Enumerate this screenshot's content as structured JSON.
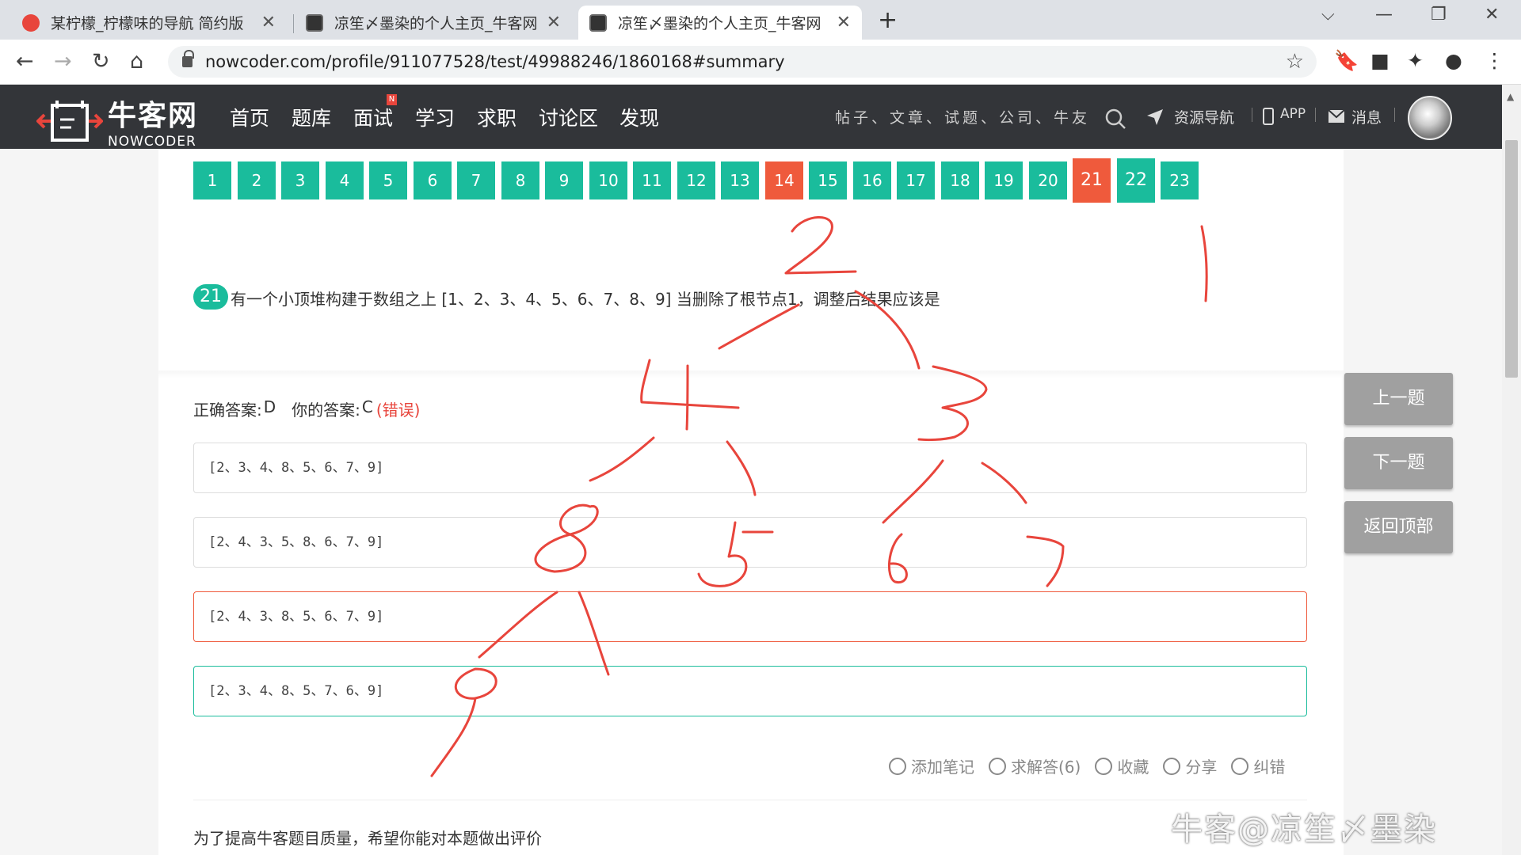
{
  "browser": {
    "tabs": [
      {
        "title": "某柠檬_柠檬味的导航 简约版",
        "active": false,
        "icon": "lemon-icon",
        "color": "#e8453c"
      },
      {
        "title": "凉笙〆墨染的个人主页_牛客网",
        "active": false,
        "icon": "nowcoder-icon",
        "color": "#333"
      },
      {
        "title": "凉笙〆墨染的个人主页_牛客网",
        "active": true,
        "icon": "nowcoder-icon",
        "color": "#333"
      }
    ],
    "url": "nowcoder.com/profile/911077528/test/49988246/1860168#summary"
  },
  "site": {
    "logo_cn": "牛客网",
    "logo_en": "NOWCODER",
    "nav": [
      "首页",
      "题库",
      "面试",
      "学习",
      "求职",
      "讨论区",
      "发现"
    ],
    "nav_badge": "N",
    "search_placeholder": "帖子、文章、试题、公司、牛友",
    "links": {
      "resources": "资源导航",
      "app": "APP",
      "messages": "消息"
    }
  },
  "question_numbers": [
    {
      "n": "1",
      "state": "ok"
    },
    {
      "n": "2",
      "state": "ok"
    },
    {
      "n": "3",
      "state": "ok"
    },
    {
      "n": "4",
      "state": "ok"
    },
    {
      "n": "5",
      "state": "ok"
    },
    {
      "n": "6",
      "state": "ok"
    },
    {
      "n": "7",
      "state": "ok"
    },
    {
      "n": "8",
      "state": "ok"
    },
    {
      "n": "9",
      "state": "ok"
    },
    {
      "n": "10",
      "state": "ok"
    },
    {
      "n": "11",
      "state": "ok"
    },
    {
      "n": "12",
      "state": "ok"
    },
    {
      "n": "13",
      "state": "ok"
    },
    {
      "n": "14",
      "state": "wrong"
    },
    {
      "n": "15",
      "state": "ok"
    },
    {
      "n": "16",
      "state": "ok"
    },
    {
      "n": "17",
      "state": "ok"
    },
    {
      "n": "18",
      "state": "ok"
    },
    {
      "n": "19",
      "state": "ok"
    },
    {
      "n": "20",
      "state": "ok"
    },
    {
      "n": "21",
      "state": "current-wrong"
    },
    {
      "n": "22",
      "state": "ok-big"
    },
    {
      "n": "23",
      "state": "ok"
    }
  ],
  "question": {
    "number": "21",
    "text": "有一个小顶堆构建于数组之上 [1、2、3、4、5、6、7、8、9] 当删除了根节点1，调整后结果应该是",
    "correct_label": "正确答案:",
    "correct": "D",
    "your_label": "你的答案:",
    "yours": "C",
    "verdict": "(错误)",
    "options": [
      "[2、3、4、8、5、6、7、9]",
      "[2、4、3、5、8、6、7、9]",
      "[2、4、3、8、5、6、7、9]",
      "[2、3、4、8、5、7、6、9]"
    ]
  },
  "actions": [
    "添加笔记",
    "求解答(6)",
    "收藏",
    "分享",
    "纠错"
  ],
  "rate_prompt": "为了提高牛客题目质量，希望你能对本题做出评价",
  "side_buttons": [
    "上一题",
    "下一题",
    "返回顶部"
  ],
  "watermark": "牛客@凉笙〆墨染",
  "colors": {
    "green": "#1abc9c",
    "red": "#ef5a3c",
    "header": "#333539",
    "ink": "#e8453c"
  }
}
